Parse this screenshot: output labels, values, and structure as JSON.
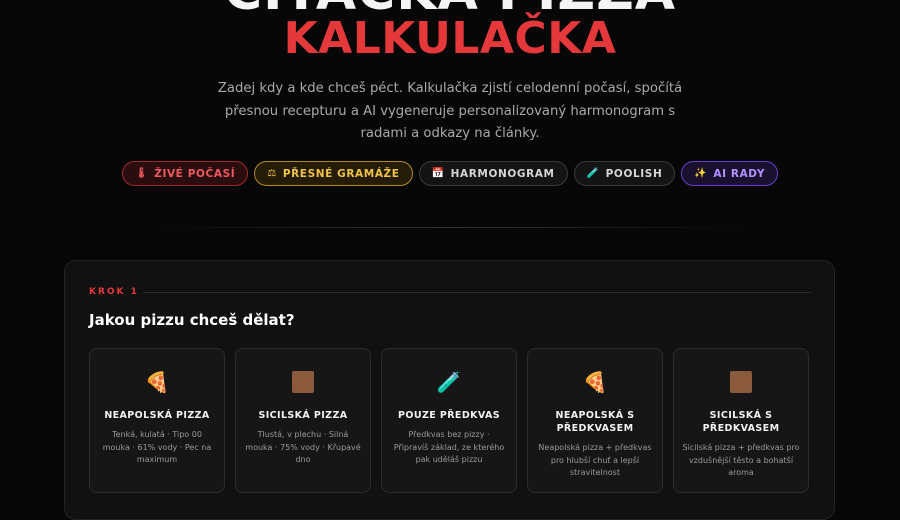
{
  "hero": {
    "title": "KALKULAČKA",
    "subtitle": "Zadej kdy a kde chceš péct. Kalkulačka zjistí celodenní počasí, spočítá přesnou recepturu a AI vygeneruje personalizovaný harmonogram s radami a odkazy na články."
  },
  "chips": [
    {
      "label": "ŽIVÉ POČASÍ",
      "icon": "🌡"
    },
    {
      "label": "PŘESNÉ GRAMÁŽE",
      "icon": "⚖"
    },
    {
      "label": "HARMONOGRAM",
      "icon": "📅"
    },
    {
      "label": "POOLISH",
      "icon": "🧪"
    },
    {
      "label": "AI RADY",
      "icon": "✨"
    }
  ],
  "step": {
    "label": "KROK 1",
    "question": "Jakou pizzu chceš dělat?"
  },
  "pizza_types": [
    {
      "title": "NEAPOLSKÁ PIZZA",
      "icon": "pizza-icon",
      "desc": "Tenká, kulatá · Tipo 00 mouka · 61% vody · Pec na maximum"
    },
    {
      "title": "SICILSKÁ PIZZA",
      "icon": "square-pizza-icon",
      "desc": "Tlustá, v plechu · Silná mouka · 75% vody · Křupavé dno"
    },
    {
      "title": "POUZE PŘEDKVAS",
      "icon": "test-tube-icon",
      "desc": "Předkvas bez pizzy · Připravíš základ, ze kterého pak uděláš pizzu"
    },
    {
      "title": "NEAPOLSKÁ S PŘEDKVASEM",
      "icon": "pizza-icon",
      "desc": "Neapolská pizza + předkvas pro hlubší chuť a lepší stravitelnost"
    },
    {
      "title": "SICILSKÁ S PŘEDKVASEM",
      "icon": "square-pizza-icon",
      "desc": "Sicilská pizza + předkvas pro vzdušnější těsto a bohatší aroma"
    }
  ],
  "colors": {
    "accent": "#e5383b",
    "background": "#070707",
    "panel": "#111111"
  }
}
